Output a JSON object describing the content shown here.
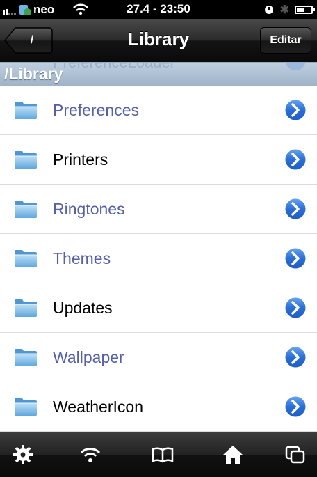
{
  "status_bar": {
    "carrier": "neo",
    "time": "27.4 - 23:50"
  },
  "nav": {
    "back_label": "/",
    "title": "Library",
    "edit_label": "Editar"
  },
  "path_header": {
    "path": "/Library",
    "scrolled_under_label": "PreferenceLoader"
  },
  "list": {
    "items": [
      {
        "label": "Preferences",
        "style": "link"
      },
      {
        "label": "Printers",
        "style": "plain"
      },
      {
        "label": "Ringtones",
        "style": "link"
      },
      {
        "label": "Themes",
        "style": "link"
      },
      {
        "label": "Updates",
        "style": "plain"
      },
      {
        "label": "Wallpaper",
        "style": "link"
      },
      {
        "label": "WeatherIcon",
        "style": "plain"
      }
    ]
  },
  "toolbar": {
    "icons": [
      "gear-icon",
      "wifi-icon",
      "book-icon",
      "home-icon",
      "windows-icon"
    ]
  },
  "colors": {
    "link_text": "#5560a8",
    "disclosure": "#2a6fd6",
    "path_header": "#a9bcd3"
  }
}
